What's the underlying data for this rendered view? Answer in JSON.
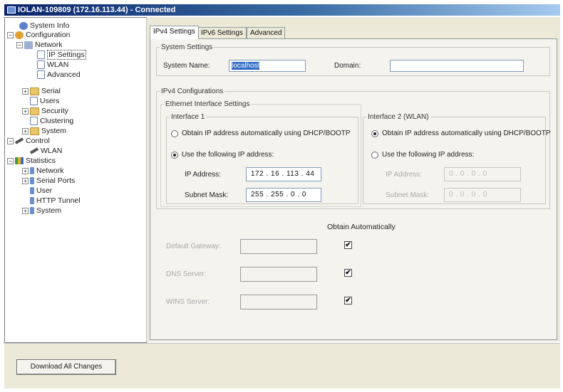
{
  "window": {
    "title": "IOLAN-109809 (172.16.113.44) - Connected"
  },
  "tree": {
    "system_info": "System Info",
    "configuration": "Configuration",
    "network": "Network",
    "ip_settings": "IP Settings",
    "wlan": "WLAN",
    "advanced": "Advanced",
    "serial": "Serial",
    "users": "Users",
    "security": "Security",
    "clustering": "Clustering",
    "system": "System",
    "control": "Control",
    "control_wlan": "WLAN",
    "statistics": "Statistics",
    "stat_network": "Network",
    "stat_serial_ports": "Serial Ports",
    "stat_user": "User",
    "stat_http_tunnel": "HTTP Tunnel",
    "stat_system": "System"
  },
  "tabs": [
    "IPv4 Settings",
    "IPv6 Settings",
    "Advanced"
  ],
  "system_settings": {
    "legend": "System Settings",
    "system_name_label": "System Name:",
    "system_name_value": "localhost",
    "domain_label": "Domain:",
    "domain_value": ""
  },
  "ipv4": {
    "legend": "IPv4 Configurations",
    "ethernet_legend": "Ethernet Interface Settings",
    "interface1": {
      "legend": "Interface 1",
      "dhcp_label": "Obtain IP address automatically using DHCP/BOOTP",
      "static_label": "Use the following IP address:",
      "ip_label": "IP Address:",
      "ip_value": "172 . 16 . 113 . 44",
      "mask_label": "Subnet Mask:",
      "mask_value": "255 . 255 . 0 . 0"
    },
    "interface2": {
      "legend": "Interface 2 (WLAN)",
      "dhcp_label": "Obtain IP address automatically using DHCP/BOOTP",
      "static_label": "Use the following IP address:",
      "ip_label": "IP Address:",
      "ip_value": "0 . 0 . 0 . 0",
      "mask_label": "Subnet Mask:",
      "mask_value": "0 . 0 . 0 . 0"
    }
  },
  "obtain": {
    "heading": "Obtain Automatically",
    "gateway_label": "Default Gateway:",
    "dns_label": "DNS Server:",
    "wins_label": "WINS Server:",
    "check_mark": "✔"
  },
  "buttons": {
    "download_all": "Download All Changes"
  }
}
